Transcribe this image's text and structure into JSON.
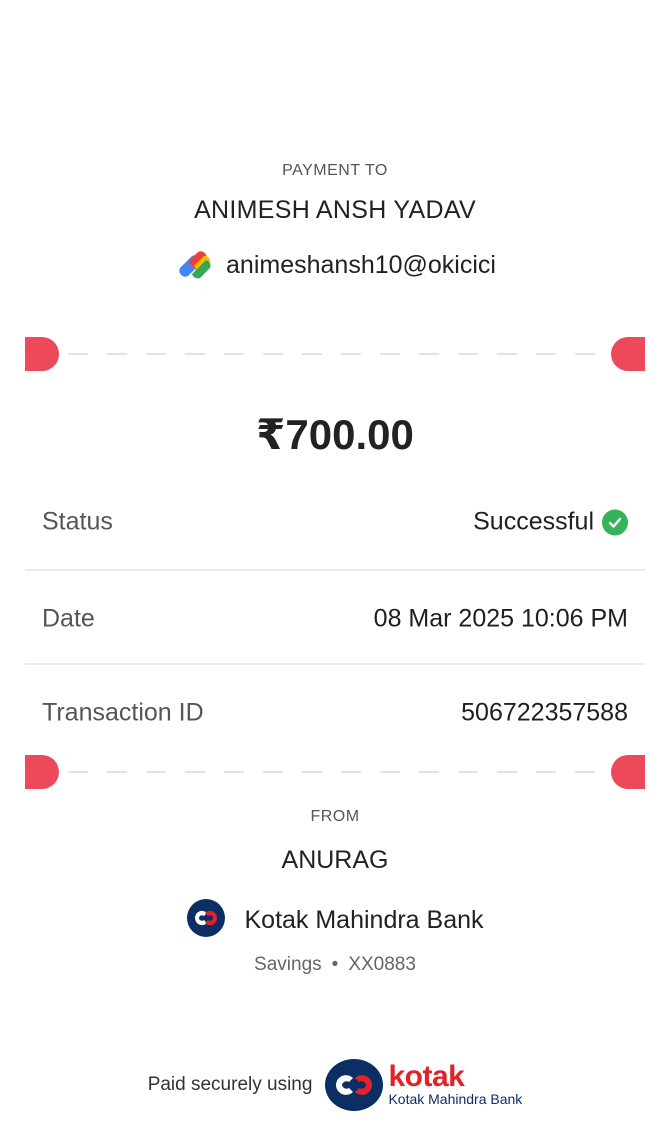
{
  "header": {
    "payment_to_label": "PAYMENT TO",
    "payee_name": "ANIMESH ANSH YADAV",
    "upi_id": "animeshansh10@okicici",
    "upi_app_icon": "google-pay-icon"
  },
  "amount": "₹700.00",
  "details": {
    "status_label": "Status",
    "status_value": "Successful",
    "date_label": "Date",
    "date_value": "08 Mar 2025 10:06 PM",
    "txn_label": "Transaction ID",
    "txn_value": "506722357588"
  },
  "from": {
    "label": "FROM",
    "name": "ANURAG",
    "bank_name": "Kotak Mahindra Bank",
    "account_type": "Savings",
    "separator": "•",
    "account_number": "XX0883"
  },
  "footer": {
    "text": "Paid securely using",
    "brand_word": "kotak",
    "brand_sub": "Kotak Mahindra Bank"
  },
  "colors": {
    "notch": "#ec4a5a",
    "success": "#34b35a",
    "kotak_red": "#e32129",
    "kotak_blue": "#0b2f64"
  }
}
